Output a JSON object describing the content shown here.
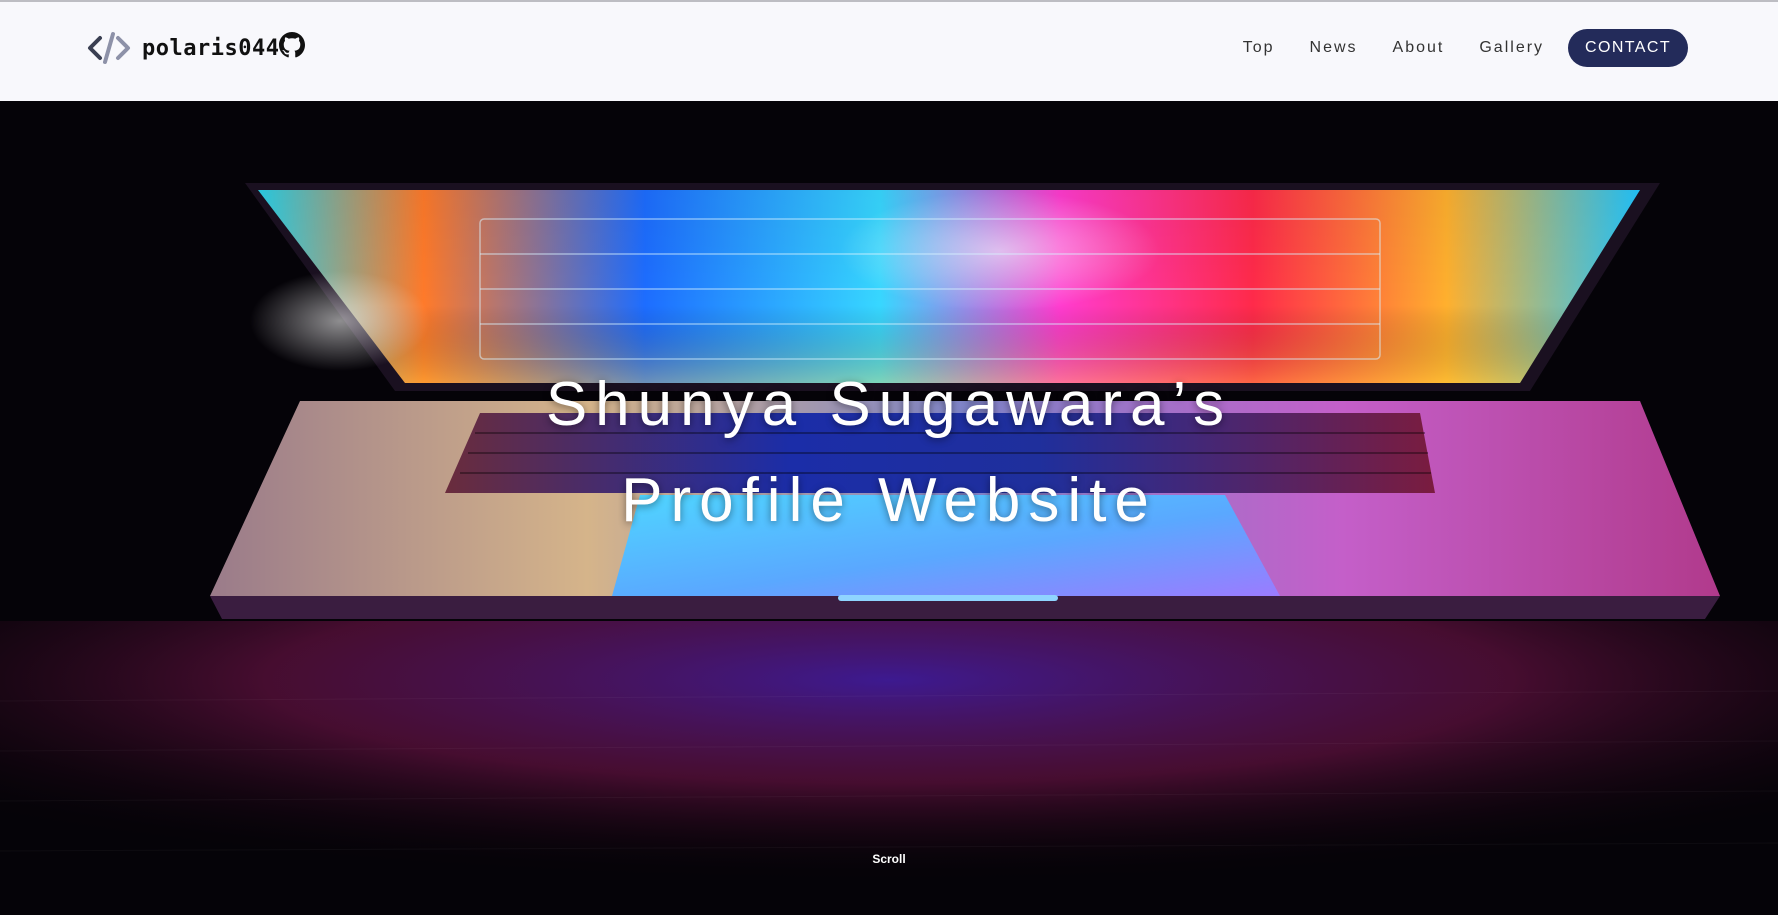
{
  "header": {
    "logo_text": "polaris044",
    "logo_icon": "code-brackets-icon",
    "github_icon": "github-icon",
    "nav": [
      {
        "label": "Top"
      },
      {
        "label": "News"
      },
      {
        "label": "About"
      },
      {
        "label": "Gallery"
      }
    ],
    "contact_label": "CONTACT",
    "colors": {
      "header_bg": "#f8f8fc",
      "contact_bg": "#232b5a"
    }
  },
  "hero": {
    "title_line1": "Shunya Sugawara’s",
    "title_line2": "Profile Website",
    "scroll_label": "Scroll",
    "image_icon": "glowing-laptop-image"
  }
}
